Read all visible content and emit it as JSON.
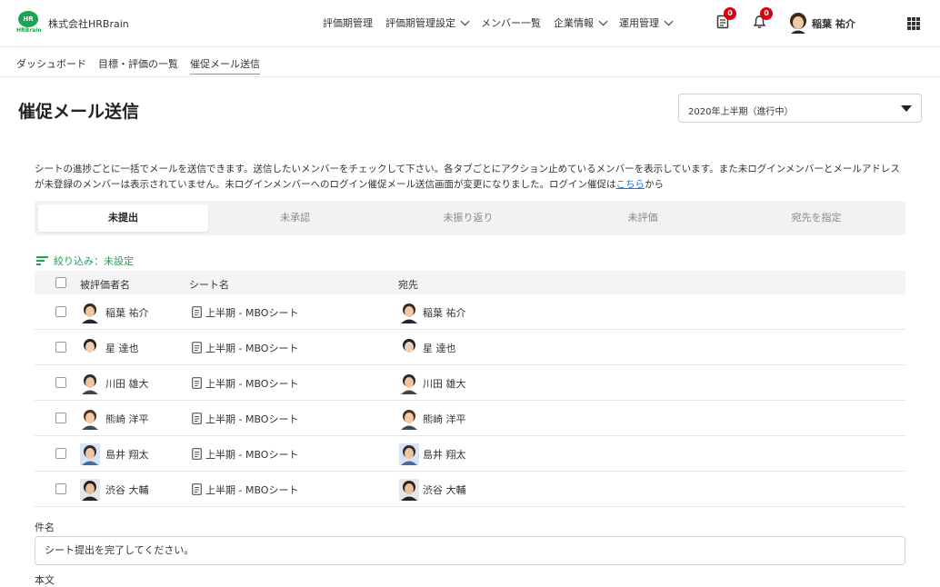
{
  "header": {
    "logo_mark": "HR",
    "logo_text": "HRBrain",
    "company": "株式会社HRBrain",
    "nav": [
      {
        "label": "評価期管理",
        "dropdown": false
      },
      {
        "label": "評価期管理設定",
        "dropdown": true
      },
      {
        "label": "メンバー一覧",
        "dropdown": false
      },
      {
        "label": "企業情報",
        "dropdown": true
      },
      {
        "label": "運用管理",
        "dropdown": true
      }
    ],
    "document_badge": "0",
    "bell_badge": "0",
    "user_name": "稲葉 祐介"
  },
  "breadcrumb": [
    "ダッシュボード",
    "目標・評価の一覧",
    "催促メール送信"
  ],
  "page_title": "催促メール送信",
  "period_select": "2020年上半期（進行中）",
  "description": {
    "text": "シートの進捗ごとに一括でメールを送信できます。送信したいメンバーをチェックして下さい。各タブごとにアクション止めているメンバーを表示しています。また未ログインメンバーとメールアドレスが未登録のメンバーは表示されていません。未ログインメンバーへのログイン催促メール送信画面が変更になりました。ログイン催促は",
    "link": "こちら",
    "suffix": "から"
  },
  "tabs": [
    "未提出",
    "未承認",
    "未振り返り",
    "未評価",
    "宛先を指定"
  ],
  "filter_label": "絞り込み：未設定",
  "table": {
    "headers": [
      "被評価者名",
      "シート名",
      "宛先"
    ],
    "rows": [
      {
        "name": "稲葉 祐介",
        "sheet": "上半期 - MBOシート",
        "to": "稲葉 祐介"
      },
      {
        "name": "星 達也",
        "sheet": "上半期 - MBOシート",
        "to": "星 達也"
      },
      {
        "name": "川田 雄大",
        "sheet": "上半期 - MBOシート",
        "to": "川田 雄大"
      },
      {
        "name": "熊崎 洋平",
        "sheet": "上半期 - MBOシート",
        "to": "熊崎 洋平"
      },
      {
        "name": "島井 翔太",
        "sheet": "上半期 - MBOシート",
        "to": "島井 翔太"
      },
      {
        "name": "渋谷 大輔",
        "sheet": "上半期 - MBOシート",
        "to": "渋谷 大輔"
      }
    ]
  },
  "subject_label": "件名",
  "subject_value": "シート提出を完了してください。",
  "body_label": "本文",
  "colors": {
    "brand": "#1aa553",
    "badge": "#d9000d",
    "link": "#1a73e8",
    "active_crumb": "#e8765a"
  }
}
